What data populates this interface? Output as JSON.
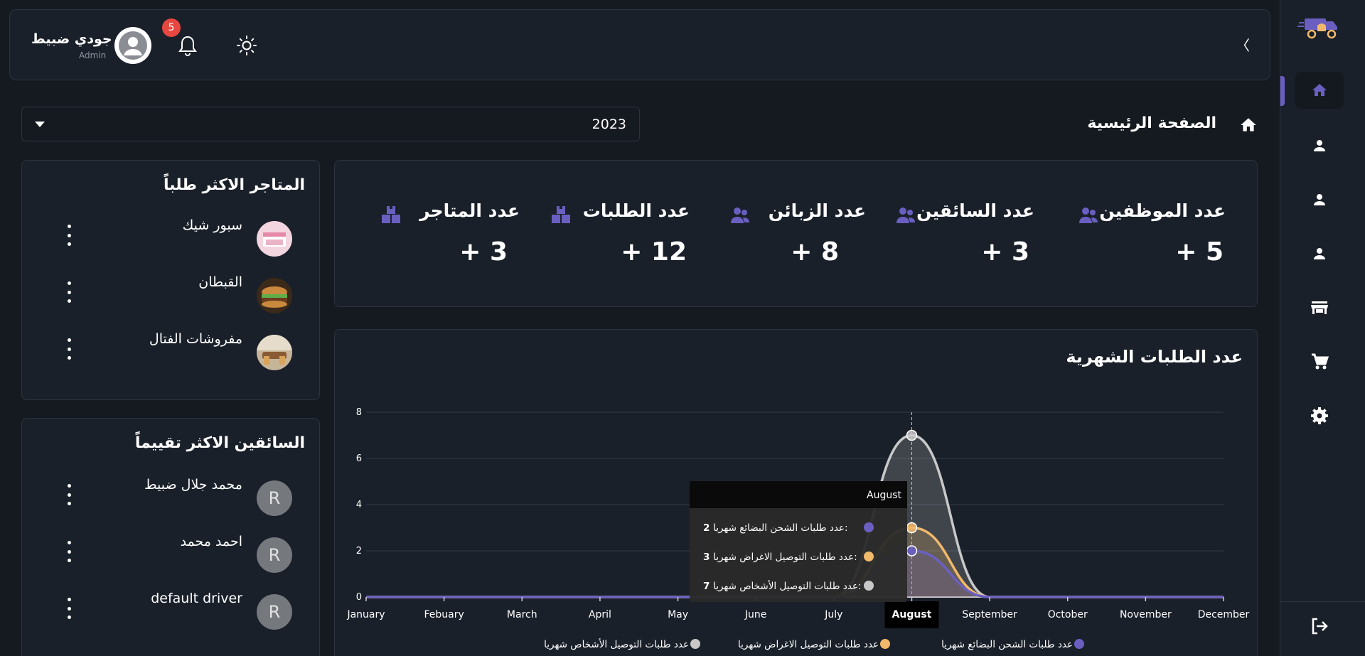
{
  "header": {
    "user_name": "جودي ضبيط",
    "user_role": "Admin",
    "notification_count": "5",
    "collapse_glyph": "〈"
  },
  "breadcrumb": {
    "title": "الصفحة الرئيسية"
  },
  "year_select": {
    "value": "2023"
  },
  "stats": [
    {
      "label": "عدد الموظفين",
      "value": "+ 5",
      "icon": "users-icon"
    },
    {
      "label": "عدد السائقين",
      "value": "+ 3",
      "icon": "users-icon"
    },
    {
      "label": "عدد الزبائن",
      "value": "+ 8",
      "icon": "users-icon"
    },
    {
      "label": "عدد الطلبات",
      "value": "+ 12",
      "icon": "boxes-icon"
    },
    {
      "label": "عدد المتاجر",
      "value": "+ 3",
      "icon": "boxes-icon"
    }
  ],
  "stores": {
    "title": "المتاجر الاكثر طلباً",
    "items": [
      {
        "name": "سبور شيك"
      },
      {
        "name": "القبطان"
      },
      {
        "name": "مفروشات الفتال"
      }
    ]
  },
  "drivers": {
    "title": "السائقين الاكثر تقييماً",
    "items": [
      {
        "name": "محمد جلال ضبيط",
        "avatar_letter": "R"
      },
      {
        "name": "احمد محمد",
        "avatar_letter": "R"
      },
      {
        "name": "default driver",
        "avatar_letter": "R"
      }
    ]
  },
  "sidebar": {
    "items": [
      "home-icon",
      "person-icon",
      "person-icon",
      "person-icon",
      "store-icon",
      "cart-icon",
      "settings-icon"
    ],
    "logout_icon": "logout-icon"
  },
  "colors": {
    "accent": "#6a5fc1",
    "series_goods": "#6a5fc1",
    "series_items": "#f2b96b",
    "series_persons": "#c8c8c8",
    "notification": "#e7473f"
  },
  "chart_data": {
    "type": "area",
    "title": "عدد الطلبات الشهرية",
    "categories": [
      "January",
      "Febuary",
      "March",
      "April",
      "May",
      "June",
      "July",
      "August",
      "September",
      "October",
      "November",
      "December"
    ],
    "ylim": [
      0,
      8
    ],
    "yticks": [
      0,
      2,
      4,
      6,
      8
    ],
    "series": [
      {
        "name": "عدد طلبات الشحن البضائع شهريا",
        "values": [
          0,
          0,
          0,
          0,
          0,
          0,
          0,
          2,
          0,
          0,
          0,
          0
        ],
        "color": "#6a5fc1"
      },
      {
        "name": "عدد طلبات التوصيل الاغراض شهريا",
        "values": [
          0,
          0,
          0,
          0,
          0,
          0,
          0,
          3,
          0,
          0,
          0,
          0
        ],
        "color": "#f2b96b"
      },
      {
        "name": "عدد طلبات التوصيل الأشخاص شهريا",
        "values": [
          0,
          0,
          0,
          0,
          0,
          0,
          0,
          7,
          0,
          0,
          0,
          0
        ],
        "color": "#c8c8c8"
      }
    ],
    "grid": true,
    "legend": "bottom",
    "tooltip": {
      "title": "August",
      "rows": [
        {
          "label": "عدد طلبات الشحن البضائع شهريا:",
          "value": "2"
        },
        {
          "label": "عدد طلبات التوصيل الاغراض شهريا:",
          "value": "3"
        },
        {
          "label": "عدد طلبات التوصيل الأشخاص شهريا:",
          "value": "7"
        }
      ]
    },
    "highlighted_category": "August"
  }
}
